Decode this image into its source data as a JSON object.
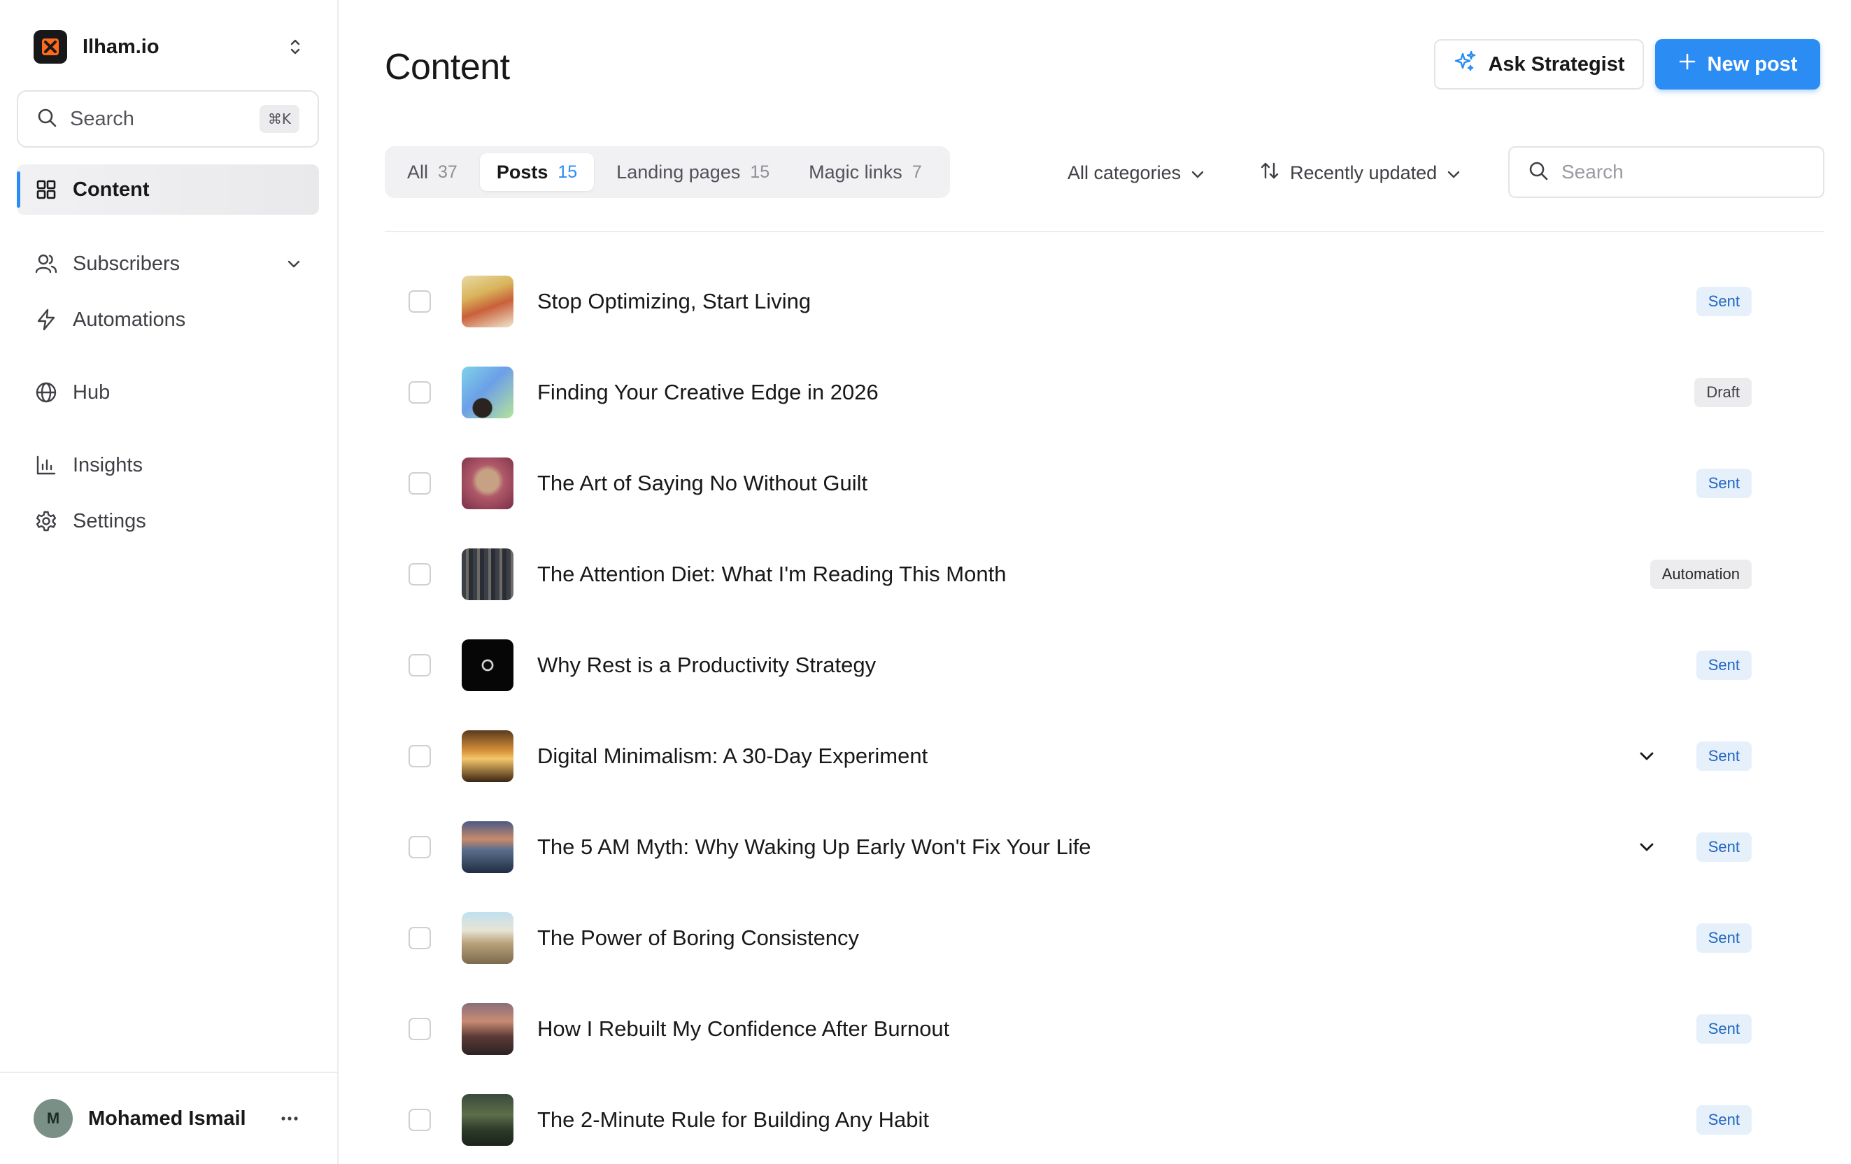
{
  "workspace": {
    "name": "Ilham.io"
  },
  "sidebar": {
    "search_label": "Search",
    "search_shortcut": "⌘K",
    "items": [
      {
        "label": "Content"
      },
      {
        "label": "Subscribers"
      },
      {
        "label": "Automations"
      },
      {
        "label": "Hub"
      },
      {
        "label": "Insights"
      },
      {
        "label": "Settings"
      }
    ]
  },
  "user": {
    "initial": "M",
    "name": "Mohamed Ismail"
  },
  "header": {
    "title": "Content",
    "ask_label": "Ask Strategist",
    "new_label": "New post"
  },
  "tabs": [
    {
      "label": "All",
      "count": "37"
    },
    {
      "label": "Posts",
      "count": "15"
    },
    {
      "label": "Landing pages",
      "count": "15"
    },
    {
      "label": "Magic links",
      "count": "7"
    }
  ],
  "filters": {
    "category": "All categories",
    "sort": "Recently updated",
    "search_placeholder": "Search"
  },
  "posts": [
    {
      "title": "Stop Optimizing, Start Living",
      "status": "Sent"
    },
    {
      "title": "Finding Your Creative Edge in 2026",
      "status": "Draft"
    },
    {
      "title": "The Art of Saying No Without Guilt",
      "status": "Sent"
    },
    {
      "title": "The Attention Diet: What I'm Reading This Month",
      "status": "Automation"
    },
    {
      "title": "Why Rest is a Productivity Strategy",
      "status": "Sent"
    },
    {
      "title": "Digital Minimalism: A 30-Day Experiment",
      "status": "Sent"
    },
    {
      "title": "The 5 AM Myth: Why Waking Up Early Won't Fix Your Life",
      "status": "Sent"
    },
    {
      "title": "The Power of Boring Consistency",
      "status": "Sent"
    },
    {
      "title": "How I Rebuilt My Confidence After Burnout",
      "status": "Sent"
    },
    {
      "title": "The 2-Minute Rule for Building Any Habit",
      "status": "Sent"
    }
  ],
  "colors": {
    "accent": "#2b8cf3",
    "sent_bg": "#e6f0fb",
    "sent_text": "#1f66c2",
    "neutral_badge_bg": "#ececee"
  }
}
